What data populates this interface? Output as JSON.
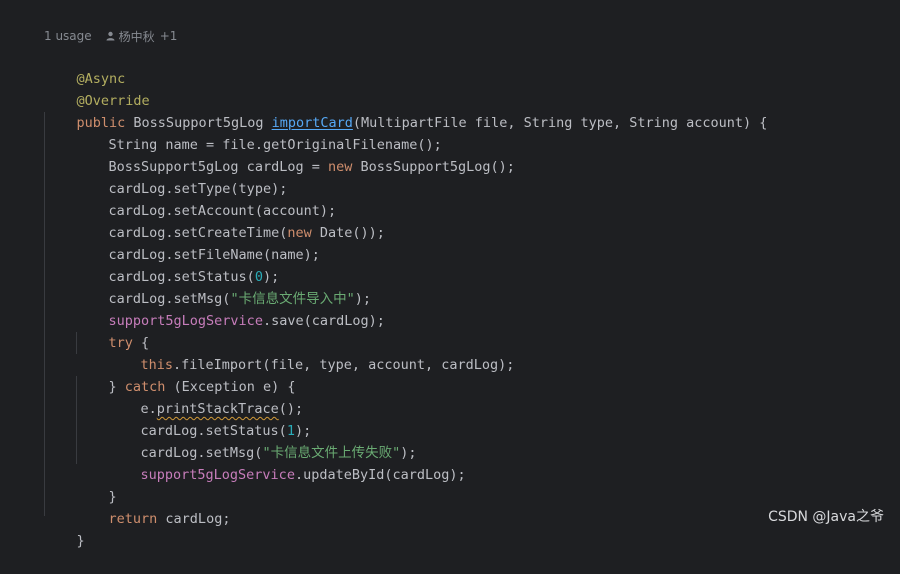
{
  "inlay_hint": {
    "usages": "1 usage",
    "author": "杨中秋",
    "extra": "+1"
  },
  "code": {
    "l1": "@Async",
    "l2": "@Override",
    "l3": {
      "kw_public": "public",
      "type": " BossSupport5gLog ",
      "method": "importCard",
      "params": "(MultipartFile file, String type, String account) {"
    },
    "l4": "String name = file.getOriginalFilename();",
    "l5": {
      "a": "BossSupport5gLog cardLog = ",
      "kw_new": "new",
      "b": " BossSupport5gLog();"
    },
    "l6": "cardLog.setType(type);",
    "l7": "cardLog.setAccount(account);",
    "l8": {
      "a": "cardLog.setCreateTime(",
      "kw_new": "new",
      "b": " Date());"
    },
    "l9": "cardLog.setFileName(name);",
    "l10": {
      "a": "cardLog.setStatus(",
      "num": "0",
      "b": ");"
    },
    "l11": {
      "a": "cardLog.setMsg(",
      "str": "\"卡信息文件导入中\"",
      "b": ");"
    },
    "l12": {
      "field": "support5gLogService",
      "b": ".save(cardLog);"
    },
    "l13": {
      "kw_try": "try",
      "b": " {"
    },
    "l14": {
      "kw_this": "this",
      "b": ".fileImport(file, type, account, cardLog);"
    },
    "l15": {
      "a": "} ",
      "kw_catch": "catch",
      "b": " (Exception e) {"
    },
    "l16": {
      "a": "e.",
      "warn": "printStackTrace",
      "b": "();"
    },
    "l17": {
      "a": "cardLog.setStatus(",
      "num": "1",
      "b": ");"
    },
    "l18": {
      "a": "cardLog.setMsg(",
      "str": "\"卡信息文件上传失败\"",
      "b": ");"
    },
    "l19": {
      "field": "support5gLogService",
      "b": ".updateById(cardLog);"
    },
    "l20": "}",
    "l21": {
      "kw_return": "return",
      "b": " cardLog;"
    },
    "l22": "}"
  },
  "watermark": "CSDN @Java之爷",
  "colors": {
    "background": "#1e1f22",
    "text": "#bcbec4",
    "keyword": "#cf8e6d",
    "annotation": "#b3ae60",
    "method_decl": "#56a8f5",
    "field": "#c77dbb",
    "string": "#6aab73",
    "number": "#2aacb8",
    "hint": "#868a91"
  }
}
